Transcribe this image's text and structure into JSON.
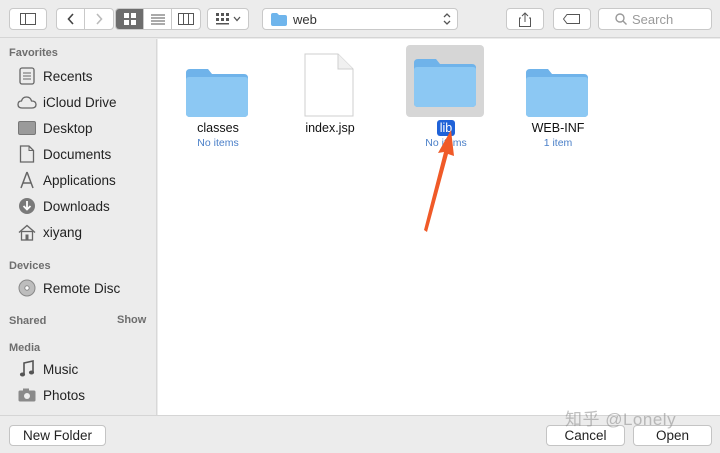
{
  "toolbar": {
    "path": "web",
    "search_placeholder": "Search"
  },
  "sidebar": {
    "favorites_title": "Favorites",
    "favorites": [
      {
        "label": "Recents",
        "icon": "clock-icon"
      },
      {
        "label": "iCloud Drive",
        "icon": "cloud-icon"
      },
      {
        "label": "Desktop",
        "icon": "desktop-icon"
      },
      {
        "label": "Documents",
        "icon": "document-icon"
      },
      {
        "label": "Applications",
        "icon": "applications-icon"
      },
      {
        "label": "Downloads",
        "icon": "download-icon"
      },
      {
        "label": "xiyang",
        "icon": "home-icon"
      }
    ],
    "devices_title": "Devices",
    "devices": [
      {
        "label": "Remote Disc",
        "icon": "disc-icon"
      }
    ],
    "shared_title": "Shared",
    "shared_show": "Show",
    "media_title": "Media",
    "media": [
      {
        "label": "Music",
        "icon": "music-icon"
      },
      {
        "label": "Photos",
        "icon": "camera-icon"
      }
    ]
  },
  "files": [
    {
      "name": "classes",
      "sub": "No items",
      "kind": "folder",
      "selected": false
    },
    {
      "name": "index.jsp",
      "sub": "",
      "kind": "document",
      "selected": false
    },
    {
      "name": "lib",
      "sub": "No items",
      "kind": "folder",
      "selected": true
    },
    {
      "name": "WEB-INF",
      "sub": "1 item",
      "kind": "folder",
      "selected": false
    }
  ],
  "buttons": {
    "new_folder": "New Folder",
    "cancel": "Cancel",
    "open": "Open"
  },
  "watermark": "知乎 @Lonely",
  "colors": {
    "folder": "#7cc0f0",
    "selection": "#1f62d8",
    "annotation_arrow": "#f05a28"
  }
}
